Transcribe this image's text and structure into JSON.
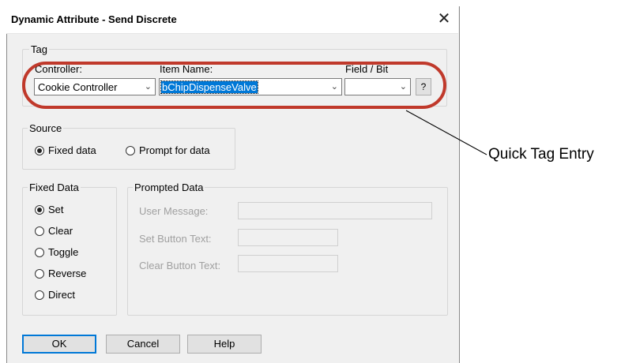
{
  "dialog": {
    "title": "Dynamic Attribute - Send Discrete",
    "close_glyph": "✕"
  },
  "tag": {
    "group_label": "Tag",
    "controller_label": "Controller:",
    "controller_value": "Cookie Controller",
    "item_name_label": "Item Name:",
    "item_name_value": "bChipDispenseValve",
    "field_bit_label": "Field / Bit",
    "field_bit_value": "",
    "help_button": "?"
  },
  "source": {
    "group_label": "Source",
    "options": [
      "Fixed data",
      "Prompt for data"
    ],
    "selected": "Fixed data"
  },
  "fixed_data": {
    "group_label": "Fixed Data",
    "options": [
      "Set",
      "Clear",
      "Toggle",
      "Reverse",
      "Direct"
    ],
    "selected": "Set"
  },
  "prompted_data": {
    "group_label": "Prompted Data",
    "user_message_label": "User Message:",
    "set_button_text_label": "Set Button Text:",
    "clear_button_text_label": "Clear Button Text:",
    "enabled": false
  },
  "buttons": {
    "ok": "OK",
    "cancel": "Cancel",
    "help": "Help"
  },
  "annotation": {
    "callout_text": "Quick Tag Entry",
    "ring_color": "#c0392b"
  },
  "icons": {
    "dropdown": "chevron-down-icon",
    "close": "close-icon"
  }
}
